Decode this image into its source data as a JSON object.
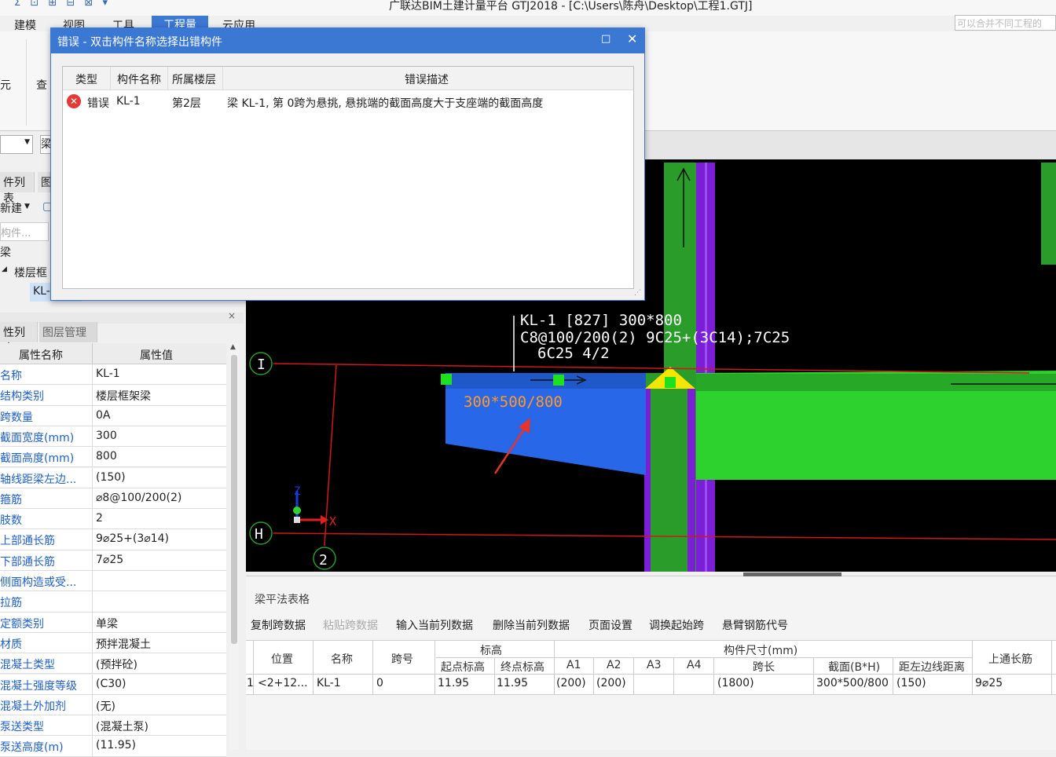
{
  "app": {
    "title": "广联达BIM土建计量平台 GTJ2018 - [C:\\Users\\陈舟\\Desktop\\工程1.GTJ]",
    "qat_icons": "Σ ⊡ ⊞ ⊟ ⊠ ▾",
    "hint": "可以合并不同工程的"
  },
  "ribbon_tabs": [
    "建模",
    "视图",
    "工具",
    "工程量",
    "云应用"
  ],
  "ribbon": {
    "left_label": "元",
    "query_label": "查"
  },
  "left": {
    "combo_value": "",
    "combo_value2": "梁",
    "tab_list": "件列表",
    "tab_layer": "图",
    "new_label": "新建",
    "search_placeholder": "构件...",
    "tree_root": "梁",
    "tree_group": "楼层框",
    "tree_item": "KL-",
    "prop_tab": "性列表",
    "layer_tab": "图层管理",
    "prop_header_name": "属性名称",
    "prop_header_value": "属性值"
  },
  "properties": [
    {
      "name": "名称",
      "value": "KL-1"
    },
    {
      "name": "结构类别",
      "value": "楼层框架梁"
    },
    {
      "name": "跨数量",
      "value": "0A"
    },
    {
      "name": "截面宽度(mm)",
      "value": "300"
    },
    {
      "name": "截面高度(mm)",
      "value": "800"
    },
    {
      "name": "轴线距梁左边...",
      "value": "(150)"
    },
    {
      "name": "箍筋",
      "value": "⌀8@100/200(2)"
    },
    {
      "name": "肢数",
      "value": "2"
    },
    {
      "name": "上部通长筋",
      "value": "9⌀25+(3⌀14)"
    },
    {
      "name": "下部通长筋",
      "value": "7⌀25"
    },
    {
      "name": "侧面构造或受...",
      "value": ""
    },
    {
      "name": "拉筋",
      "value": ""
    },
    {
      "name": "定额类别",
      "value": "单梁"
    },
    {
      "name": "材质",
      "value": "预拌混凝土"
    },
    {
      "name": "混凝土类型",
      "value": "(预拌砼)"
    },
    {
      "name": "混凝土强度等级",
      "value": "(C30)"
    },
    {
      "name": "混凝土外加剂",
      "value": "(无)"
    },
    {
      "name": "泵送类型",
      "value": "(混凝土泵)"
    },
    {
      "name": "泵送高度(m)",
      "value": "(11.95)"
    }
  ],
  "dialog": {
    "title": "错误 - 双击构件名称选择出错构件",
    "max_icon": "□",
    "close_icon": "✕",
    "columns": [
      "类型",
      "构件名称",
      "所属楼层",
      "错误描述"
    ],
    "row": {
      "type": "错误",
      "component": "KL-1",
      "floor": "第2层",
      "description": "梁 KL-1, 第 0跨为悬挑, 悬挑端的截面高度大于支座端的截面高度"
    }
  },
  "viewport": {
    "label_line1": "KL-1 [827] 300*800",
    "label_line2": "C8@100/200(2) 9C25+(3C14);7C25",
    "label_line3": "6C25 4/2",
    "section_label": "300*500/800",
    "axis_i": "I",
    "axis_h": "H",
    "axis_2": "2",
    "axis_x": "X",
    "axis_z": "Z"
  },
  "bottom": {
    "title": "梁平法表格",
    "toolbar": [
      "复制跨数据",
      "粘贴跨数据",
      "输入当前列数据",
      "删除当前列数据",
      "页面设置",
      "调换起始跨",
      "悬臂钢筋代号"
    ],
    "headers": {
      "position": "位置",
      "name": "名称",
      "span": "跨号",
      "elevation": "标高",
      "start_elev": "起点标高",
      "end_elev": "终点标高",
      "size": "构件尺寸(mm)",
      "a1": "A1",
      "a2": "A2",
      "a3": "A3",
      "a4": "A4",
      "span_len": "跨长",
      "section": "截面(B*H)",
      "dist_left": "距左边线距离",
      "top_bar": "上通长筋"
    },
    "row": {
      "index": "1",
      "position": "<2+12...",
      "name": "KL-1",
      "span": "0",
      "start_elev": "11.95",
      "end_elev": "11.95",
      "a1": "(200)",
      "a2": "(200)",
      "a3": "",
      "a4": "",
      "span_len": "(1800)",
      "section": "300*500/800",
      "dist_left": "(150)",
      "top_bar": "9⌀25"
    }
  }
}
